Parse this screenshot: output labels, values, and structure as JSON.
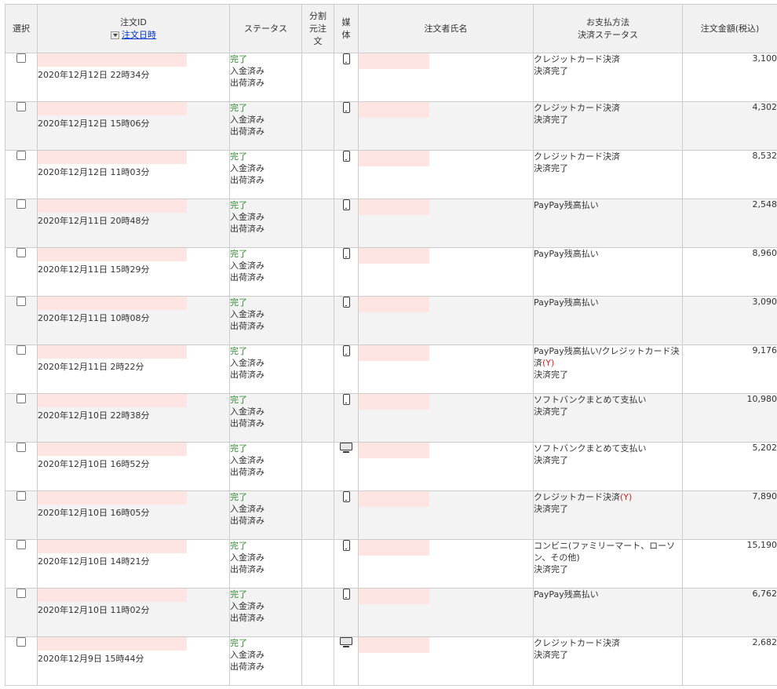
{
  "header": {
    "select": "選択",
    "order_id": "注文ID",
    "order_date_sort": "注文日時",
    "status": "ステータス",
    "split_source": "分割元注文",
    "device": "媒体",
    "customer_name": "注文者氏名",
    "payment_line1": "お支払方法",
    "payment_line2": "決済ステータス",
    "amount": "注文金額(税込)"
  },
  "icons": {
    "sort": "sort-dropdown-icon",
    "smartphone": "smartphone-icon",
    "pc": "desktop-monitor-icon"
  },
  "colors": {
    "status_complete": "#2e8b2e",
    "pay_y_mark": "#e02020",
    "masked_field": "#ffe4e4",
    "link": "#0033cc"
  },
  "orders": [
    {
      "date": "2020年12月12日 22時34分",
      "status": "完了",
      "payment_status": "入金済み",
      "shipping_status": "出荷済み",
      "device": "smartphone",
      "payment_method": "クレジットカード決済",
      "payment_method_extra": "",
      "payment_result": "決済完了",
      "amount": "3,100"
    },
    {
      "date": "2020年12月12日 15時06分",
      "status": "完了",
      "payment_status": "入金済み",
      "shipping_status": "出荷済み",
      "device": "smartphone",
      "payment_method": "クレジットカード決済",
      "payment_method_extra": "",
      "payment_result": "決済完了",
      "amount": "4,302"
    },
    {
      "date": "2020年12月12日 11時03分",
      "status": "完了",
      "payment_status": "入金済み",
      "shipping_status": "出荷済み",
      "device": "smartphone",
      "payment_method": "クレジットカード決済",
      "payment_method_extra": "",
      "payment_result": "決済完了",
      "amount": "8,532"
    },
    {
      "date": "2020年12月11日 20時48分",
      "status": "完了",
      "payment_status": "入金済み",
      "shipping_status": "出荷済み",
      "device": "smartphone",
      "payment_method": "PayPay残高払い",
      "payment_method_extra": "",
      "payment_result": "",
      "amount": "2,548"
    },
    {
      "date": "2020年12月11日 15時29分",
      "status": "完了",
      "payment_status": "入金済み",
      "shipping_status": "出荷済み",
      "device": "smartphone",
      "payment_method": "PayPay残高払い",
      "payment_method_extra": "",
      "payment_result": "",
      "amount": "8,960"
    },
    {
      "date": "2020年12月11日 10時08分",
      "status": "完了",
      "payment_status": "入金済み",
      "shipping_status": "出荷済み",
      "device": "smartphone",
      "payment_method": "PayPay残高払い",
      "payment_method_extra": "",
      "payment_result": "",
      "amount": "3,090"
    },
    {
      "date": "2020年12月11日 2時22分",
      "status": "完了",
      "payment_status": "入金済み",
      "shipping_status": "出荷済み",
      "device": "smartphone",
      "payment_method": "PayPay残高払い/クレジットカード決済",
      "payment_method_extra": "(Y)",
      "payment_result": "決済完了",
      "amount": "9,176"
    },
    {
      "date": "2020年12月10日 22時38分",
      "status": "完了",
      "payment_status": "入金済み",
      "shipping_status": "出荷済み",
      "device": "smartphone",
      "payment_method": "ソフトバンクまとめて支払い",
      "payment_method_extra": "",
      "payment_result": "決済完了",
      "amount": "10,980"
    },
    {
      "date": "2020年12月10日 16時52分",
      "status": "完了",
      "payment_status": "入金済み",
      "shipping_status": "出荷済み",
      "device": "pc",
      "payment_method": "ソフトバンクまとめて支払い",
      "payment_method_extra": "",
      "payment_result": "決済完了",
      "amount": "5,202"
    },
    {
      "date": "2020年12月10日 16時05分",
      "status": "完了",
      "payment_status": "入金済み",
      "shipping_status": "出荷済み",
      "device": "smartphone",
      "payment_method": "クレジットカード決済",
      "payment_method_extra": "(Y)",
      "payment_result": "決済完了",
      "amount": "7,890"
    },
    {
      "date": "2020年12月10日 14時21分",
      "status": "完了",
      "payment_status": "入金済み",
      "shipping_status": "出荷済み",
      "device": "smartphone",
      "payment_method": "コンビニ(ファミリーマート、ローソン、その他)",
      "payment_method_extra": "",
      "payment_result": "決済完了",
      "amount": "15,190"
    },
    {
      "date": "2020年12月10日 11時02分",
      "status": "完了",
      "payment_status": "入金済み",
      "shipping_status": "出荷済み",
      "device": "smartphone",
      "payment_method": "PayPay残高払い",
      "payment_method_extra": "",
      "payment_result": "",
      "amount": "6,762"
    },
    {
      "date": "2020年12月9日 15時44分",
      "status": "完了",
      "payment_status": "入金済み",
      "shipping_status": "出荷済み",
      "device": "pc",
      "payment_method": "クレジットカード決済",
      "payment_method_extra": "",
      "payment_result": "決済完了",
      "amount": "2,682"
    }
  ]
}
